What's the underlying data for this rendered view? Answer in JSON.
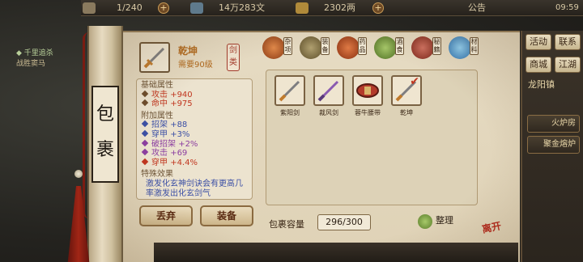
{
  "topbar": {
    "energy": "1/240",
    "silver": "14万283文",
    "gold": "2302两",
    "announce": "公告",
    "clock": "09:59"
  },
  "quest": {
    "line1": "千里追杀",
    "line2": "战胜窦马"
  },
  "scroll": {
    "title_char1": "包",
    "title_char2": "裹"
  },
  "selected_item": {
    "name": "乾坤",
    "requirement": "需要90级",
    "type": "剑类"
  },
  "stats": {
    "base_header": "基础属性",
    "base": [
      {
        "label": "攻击",
        "value": "+940"
      },
      {
        "label": "命中",
        "value": "+975"
      }
    ],
    "extra_header": "附加属性",
    "extra": [
      {
        "label": "招架",
        "value": "+88",
        "tone": "blue"
      },
      {
        "label": "穿甲",
        "value": "+3%",
        "tone": "blue"
      },
      {
        "label": "破招架",
        "value": "+2%",
        "tone": "purple"
      },
      {
        "label": "攻击",
        "value": "+69",
        "tone": "purple"
      },
      {
        "label": "穿甲",
        "value": "+4.4%",
        "tone": "red"
      }
    ],
    "special_header": "特殊效果",
    "special_text1": "激发化玄神剑诀会有更高几",
    "special_text2": "率激发出化玄剑气"
  },
  "buttons": {
    "discard": "丢弃",
    "equip": "装备"
  },
  "categories": [
    {
      "label": "杂项",
      "color": "#b04a1e"
    },
    {
      "label": "装备",
      "color": "#7b6a3a"
    },
    {
      "label": "药品",
      "color": "#c2572b"
    },
    {
      "label": "酒食",
      "color": "#6a8b3a"
    },
    {
      "label": "秘籍",
      "color": "#a33a2b"
    },
    {
      "label": "材料",
      "color": "#3e86c8"
    }
  ],
  "bag_items": [
    {
      "name": "紫阳剑",
      "color": "#c07a2c"
    },
    {
      "name": "裁风剑",
      "color": "#8a5ab0"
    },
    {
      "name": "蓉牛腰带",
      "color": "#b33a2a"
    },
    {
      "name": "乾坤",
      "color": "#c07a2c"
    }
  ],
  "bag": {
    "capacity_label": "包裹容量",
    "capacity_value": "296/300",
    "sort": "整理",
    "leave_seal": "离开"
  },
  "right_panel": {
    "b1": "活动",
    "b2": "联系",
    "b3": "商城",
    "b4": "江湖",
    "b5": "龙阳镇",
    "b6": "火炉房",
    "b7": "聚金熔炉"
  }
}
